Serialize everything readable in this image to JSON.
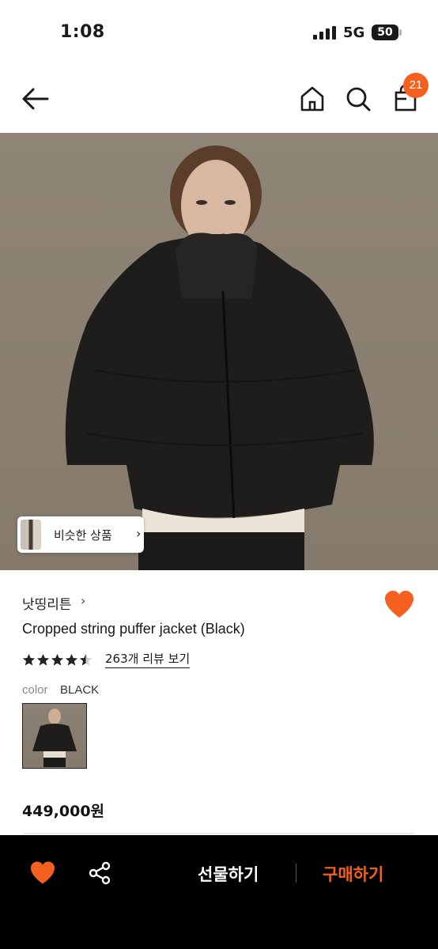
{
  "status_bar": {
    "time": "1:08",
    "network": "5G",
    "battery": "50"
  },
  "header": {
    "cart_count": "21",
    "icons": [
      "back-arrow-icon",
      "home-icon",
      "search-icon",
      "cart-icon"
    ]
  },
  "hero": {
    "similar_label": "비슷한 상품",
    "similar_chevron": "›"
  },
  "product": {
    "brand": "낫띵리튼",
    "brand_chevron": "›",
    "name": "Cropped string puffer jacket (Black)",
    "rating": 4.5,
    "review_link": "263개 리뷰 보기",
    "color_label": "color",
    "color_value": "BLACK",
    "price": "449,000원",
    "liked": true
  },
  "bottom_bar": {
    "gift_label": "선물하기",
    "buy_label": "구매하기"
  },
  "colors": {
    "accent": "#f4601f",
    "bottom_bar_bg": "#000000"
  }
}
